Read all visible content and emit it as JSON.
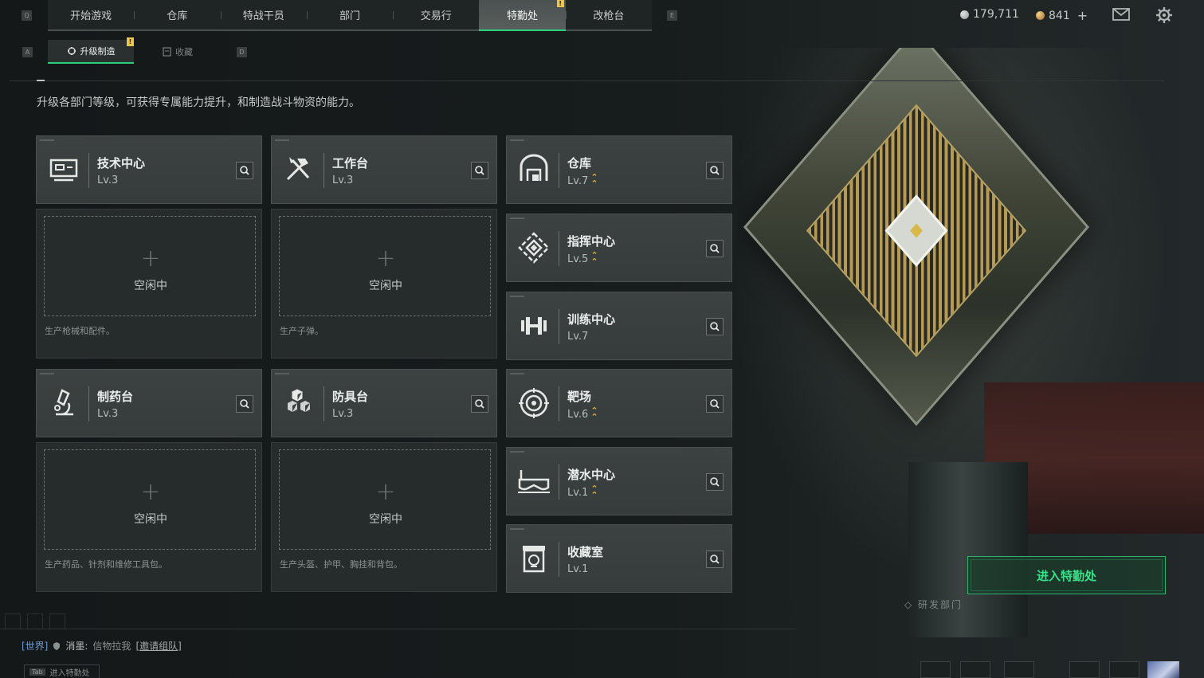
{
  "keys": {
    "q": "Q",
    "e": "E",
    "a": "A",
    "d": "D"
  },
  "nav": {
    "tabs": [
      {
        "label": "开始游戏"
      },
      {
        "label": "仓库"
      },
      {
        "label": "特战干员"
      },
      {
        "label": "部门"
      },
      {
        "label": "交易行"
      },
      {
        "label": "特勤处",
        "active": true,
        "badge": "!"
      },
      {
        "label": "改枪台"
      }
    ]
  },
  "currency": {
    "silver": "179,711",
    "gold": "841",
    "add": "+"
  },
  "subtabs": [
    {
      "label": "升级制造",
      "active": true,
      "badge": "!"
    },
    {
      "label": "收藏",
      "active": false
    }
  ],
  "description": "升级各部门等级，可获得专属能力提升，和制造战斗物资的能力。",
  "facilities_left": [
    {
      "name": "技术中心",
      "level": "Lv.3",
      "icon": "computer-icon",
      "upgradable": false
    },
    {
      "name": "工作台",
      "level": "Lv.3",
      "icon": "tools-icon",
      "upgradable": false
    },
    {
      "name": "制药台",
      "level": "Lv.3",
      "icon": "microscope-icon",
      "upgradable": false
    },
    {
      "name": "防具台",
      "level": "Lv.3",
      "icon": "armor-blocks-icon",
      "upgradable": false
    }
  ],
  "slots": [
    {
      "plus": "+",
      "status": "空闲中",
      "note": "生产枪械和配件。"
    },
    {
      "plus": "+",
      "status": "空闲中",
      "note": "生产子弹。"
    },
    {
      "plus": "+",
      "status": "空闲中",
      "note": "生产药品、针剂和维修工具包。"
    },
    {
      "plus": "+",
      "status": "空闲中",
      "note": "生产头盔、护甲、胸挂和背包。"
    }
  ],
  "facilities_right": [
    {
      "name": "仓库",
      "level": "Lv.7",
      "icon": "warehouse-icon",
      "upgradable": true
    },
    {
      "name": "指挥中心",
      "level": "Lv.5",
      "icon": "command-icon",
      "upgradable": true
    },
    {
      "name": "训练中心",
      "level": "Lv.7",
      "icon": "dumbbell-icon",
      "upgradable": false
    },
    {
      "name": "靶场",
      "level": "Lv.6",
      "icon": "target-icon",
      "upgradable": true
    },
    {
      "name": "潜水中心",
      "level": "Lv.1",
      "icon": "diving-mask-icon",
      "upgradable": true
    },
    {
      "name": "收藏室",
      "level": "Lv.1",
      "icon": "collection-icon",
      "upgradable": false
    }
  ],
  "enter_button": "进入特勤处",
  "scene_sign": "◇ 研发部门",
  "chat": {
    "channel": "[世界]",
    "user": "消墨:",
    "message": "信物拉我",
    "invite": "[邀请组队]"
  },
  "tab_hint": {
    "key": "Tab",
    "label": "进入特勤处"
  },
  "colors": {
    "accent": "#2ad17a",
    "warning": "#e9c54a",
    "upgrade": "#e0b447"
  }
}
